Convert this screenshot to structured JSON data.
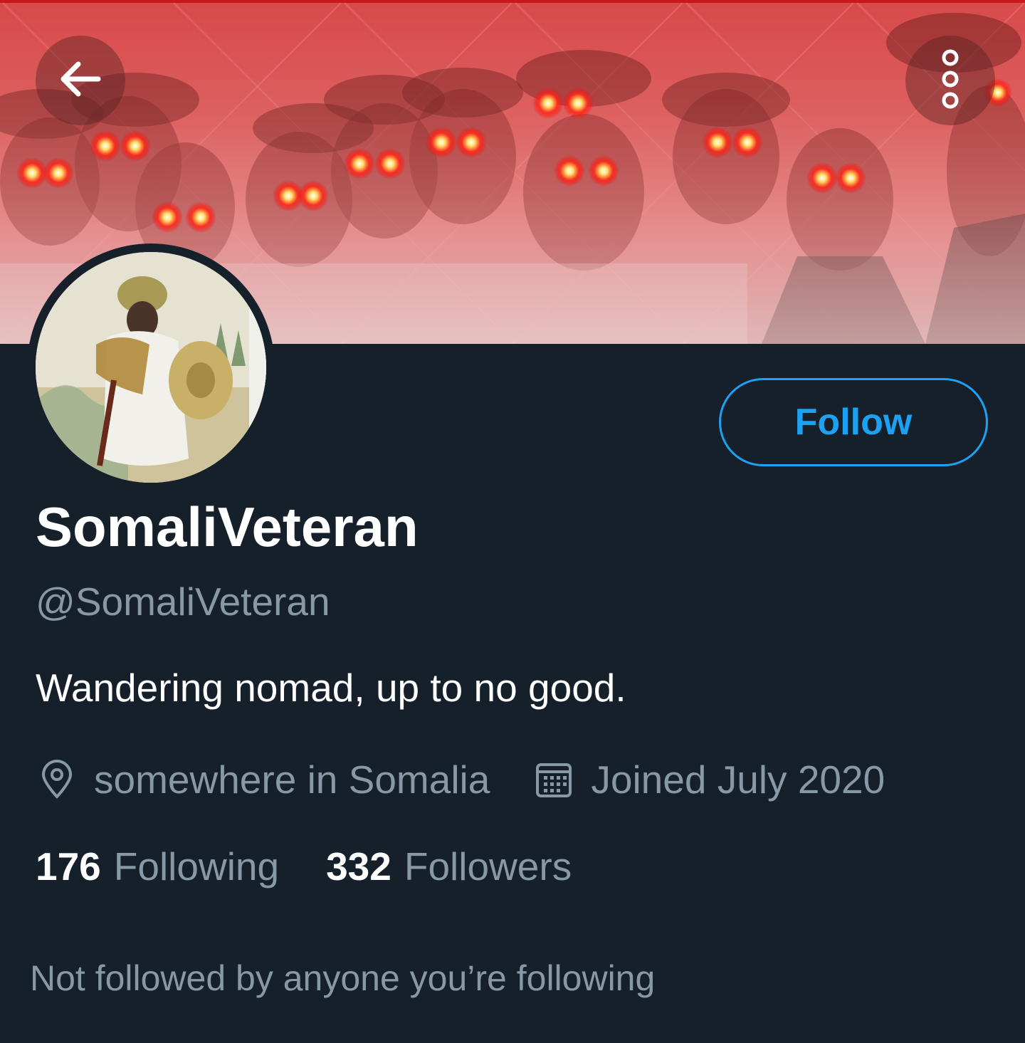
{
  "colors": {
    "background": "#15202b",
    "accent": "#1da1f2",
    "primary_text": "#ffffff",
    "secondary_text": "#8899a6",
    "banner_red": "#e06060"
  },
  "header": {
    "back_icon": "arrow-left-icon",
    "more_icon": "more-vertical-icon"
  },
  "profile": {
    "display_name": "SomaliVeteran",
    "handle": "@SomaliVeteran",
    "bio": "Wandering nomad, up to no good.",
    "location_icon": "location-pin-icon",
    "location": "somewhere in Somalia",
    "joined_icon": "calendar-icon",
    "joined": "Joined July 2020",
    "follow_label": "Follow",
    "following_count": "176",
    "following_label": "Following",
    "followers_count": "332",
    "followers_label": "Followers",
    "not_followed_text": "Not followed by anyone you’re following"
  }
}
